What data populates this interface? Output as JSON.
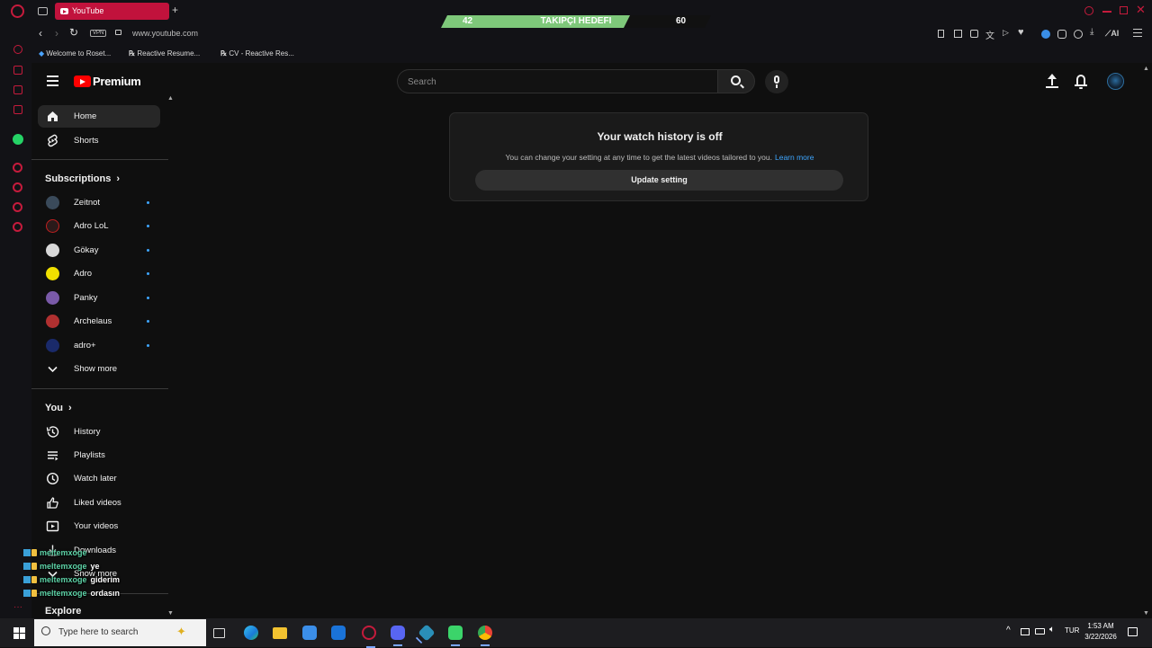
{
  "browser": {
    "tab_title": "YouTube",
    "new_tab_label": "+",
    "url": "www.youtube.com",
    "vpn_label": "VPN",
    "ai_label": "AI",
    "bookmarks": [
      {
        "label": "Welcome to Roset..."
      },
      {
        "label": "Reactive Resume..."
      },
      {
        "label": "CV - Reactive Res..."
      }
    ]
  },
  "overlay": {
    "current": "42",
    "goal_label": "TAKIPÇI HEDEFI",
    "target": "60",
    "progress_fraction": 0.7
  },
  "masthead": {
    "logo_text": "Premium",
    "search_placeholder": "Search"
  },
  "sidebar": {
    "main": [
      {
        "label": "Home",
        "icon": "home-icon",
        "active": true
      },
      {
        "label": "Shorts",
        "icon": "shorts-icon"
      }
    ],
    "subscriptions_heading": "Subscriptions",
    "subscriptions": [
      {
        "label": "Zeitnot",
        "color": "#3a4a5a"
      },
      {
        "label": "Adro LoL",
        "color": "#2a1a1a"
      },
      {
        "label": "Gökay",
        "color": "#d8d8d8"
      },
      {
        "label": "Adro",
        "color": "#f0e000"
      },
      {
        "label": "Panky",
        "color": "#7a5aa8"
      },
      {
        "label": "Archelaus",
        "color": "#b03030"
      },
      {
        "label": "adro+",
        "color": "#1a2a6a"
      }
    ],
    "show_more": "Show more",
    "you_heading": "You",
    "you_items": [
      {
        "label": "History",
        "icon": "history-icon"
      },
      {
        "label": "Playlists",
        "icon": "playlists-icon"
      },
      {
        "label": "Watch later",
        "icon": "watch-later-icon"
      },
      {
        "label": "Liked videos",
        "icon": "liked-videos-icon"
      },
      {
        "label": "Your videos",
        "icon": "your-videos-icon"
      },
      {
        "label": "Downloads",
        "icon": "downloads-icon"
      }
    ],
    "you_show_more": "Show more",
    "explore_heading": "Explore"
  },
  "history_card": {
    "title": "Your watch history is off",
    "description": "You can change your setting at any time to get the latest videos tailored to you.",
    "learn_more": "Learn more",
    "button": "Update setting"
  },
  "chat": [
    {
      "user": "meltemxoge",
      "message": ""
    },
    {
      "user": "meltemxoge",
      "message": "ye"
    },
    {
      "user": "meltemxoge",
      "message": "giderim"
    },
    {
      "user": "meltemxoge",
      "message": "ordasın"
    }
  ],
  "taskbar": {
    "search_placeholder": "Type here to search",
    "language": "TUR",
    "time": "1:53 AM",
    "date": "3/22/2026"
  }
}
